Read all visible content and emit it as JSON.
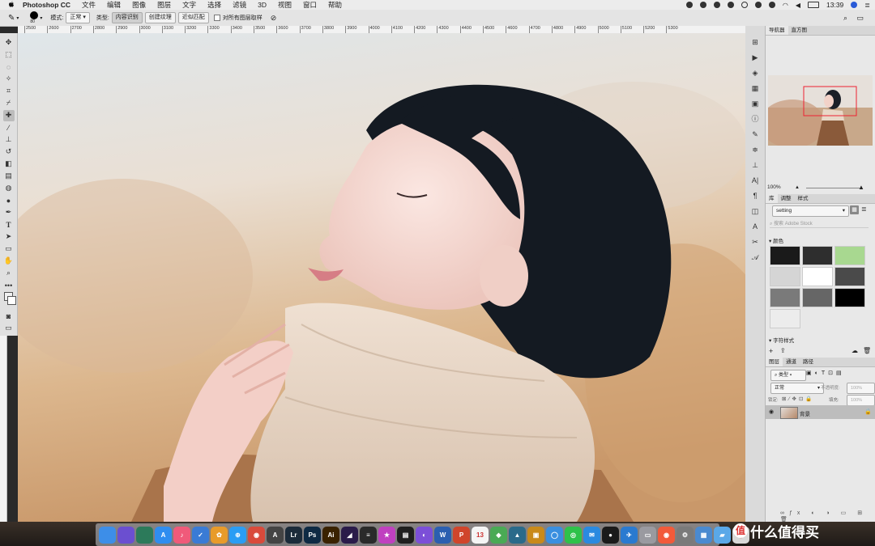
{
  "menubar": {
    "apple": "",
    "app_name": "Photoshop CC",
    "menus": [
      "文件",
      "编辑",
      "图像",
      "图层",
      "文字",
      "选择",
      "滤镜",
      "3D",
      "视图",
      "窗口",
      "帮助"
    ],
    "time": "13:39"
  },
  "options": {
    "brush_size": "80",
    "mode_label": "模式:",
    "mode_value": "正常",
    "type_label": "类型:",
    "type_buttons": [
      "内容识别",
      "创建纹理",
      "近似匹配"
    ],
    "sample_all_label": "对所有图层取样"
  },
  "ruler": [
    "2500",
    "2600",
    "2700",
    "2800",
    "2900",
    "3000",
    "3100",
    "3200",
    "3300",
    "3400",
    "3500",
    "3600",
    "3700",
    "3800",
    "3900",
    "4000",
    "4100",
    "4200",
    "4300",
    "4400",
    "4500",
    "4600",
    "4700",
    "4800",
    "4900",
    "5000",
    "5100",
    "5200",
    "5300"
  ],
  "navigator": {
    "tabs": [
      "导航器",
      "直方图"
    ],
    "zoom": "100%"
  },
  "library": {
    "tabs": [
      "库",
      "调整",
      "样式"
    ],
    "dropdown": "setting",
    "search_placeholder": "搜索 Adobe Stock",
    "colors_label": "颜色",
    "char_styles_label": "字符样式",
    "swatches": [
      "#1a1a1a",
      "#2e2e2e",
      "#a8d890",
      "#d5d5d5",
      "#ffffff",
      "#4a4a4a",
      "#7a7a7a",
      "#666666",
      "#000000",
      "#ececec"
    ]
  },
  "layers": {
    "tabs": [
      "图层",
      "通道",
      "路径"
    ],
    "filter": "类型",
    "blend": "正常",
    "opacity_label": "不透明度:",
    "opacity_value": "100%",
    "lock_label": "锁定:",
    "fill_label": "填充:",
    "fill_value": "100%",
    "layer_name": "背景"
  },
  "dock": {
    "apps": [
      {
        "name": "finder-icon",
        "label": "",
        "color": "#3d8ee8"
      },
      {
        "name": "siri-icon",
        "label": "",
        "color": "#6b4fd0"
      },
      {
        "name": "time-machine-icon",
        "label": "",
        "color": "#2c7a5a"
      },
      {
        "name": "app-store-icon",
        "label": "A",
        "color": "#2f8df0"
      },
      {
        "name": "music-icon",
        "label": "♪",
        "color": "#f05a7a"
      },
      {
        "name": "mail-icon",
        "label": "✓",
        "color": "#3a7bd5"
      },
      {
        "name": "photos-icon",
        "label": "✿",
        "color": "#e89b2a"
      },
      {
        "name": "safari-icon",
        "label": "⊕",
        "color": "#2a9df4"
      },
      {
        "name": "chrome-icon",
        "label": "◉",
        "color": "#d94a3b"
      },
      {
        "name": "typora-icon",
        "label": "A",
        "color": "#444444"
      },
      {
        "name": "lightroom-icon",
        "label": "Lr",
        "color": "#1b2b3a"
      },
      {
        "name": "photoshop-icon",
        "label": "Ps",
        "color": "#0e2a44"
      },
      {
        "name": "illustrator-icon",
        "label": "Ai",
        "color": "#3a2200"
      },
      {
        "name": "premiere-icon",
        "label": "◢",
        "color": "#2a1b4a"
      },
      {
        "name": "menu-app-icon",
        "label": "≡",
        "color": "#2a2a2a"
      },
      {
        "name": "star-app-icon",
        "label": "★",
        "color": "#c040c0"
      },
      {
        "name": "clapper-icon",
        "label": "▤",
        "color": "#1f1f1f"
      },
      {
        "name": "pixel-app-icon",
        "label": "◐",
        "color": "#7c4fd8"
      },
      {
        "name": "word-icon",
        "label": "W",
        "color": "#2b5fb0"
      },
      {
        "name": "powerpoint-icon",
        "label": "P",
        "color": "#d0452b"
      },
      {
        "name": "calendar-icon",
        "label": "13",
        "color": "#f5f5f5"
      },
      {
        "name": "maps-icon",
        "label": "◆",
        "color": "#4aaa55"
      },
      {
        "name": "vpn-icon",
        "label": "▲",
        "color": "#2a6a8a"
      },
      {
        "name": "package-icon",
        "label": "▣",
        "color": "#c98a1a"
      },
      {
        "name": "qq-chat-icon",
        "label": "◯",
        "color": "#3a8fe0"
      },
      {
        "name": "wechat-icon",
        "label": "◎",
        "color": "#2ec24a"
      },
      {
        "name": "wechat-work-icon",
        "label": "✉",
        "color": "#2a8ae0"
      },
      {
        "name": "qq-icon",
        "label": "●",
        "color": "#1a1a1a"
      },
      {
        "name": "plane-icon",
        "label": "✈",
        "color": "#2a7ad0"
      },
      {
        "name": "screen-app-icon",
        "label": "▭",
        "color": "#9a9aa0"
      },
      {
        "name": "record-icon",
        "label": "◉",
        "color": "#f25a3a"
      },
      {
        "name": "settings-icon",
        "label": "⚙",
        "color": "#7a7a7a"
      },
      {
        "name": "preview-icon",
        "label": "▦",
        "color": "#4a8ad0"
      },
      {
        "name": "folder-icon",
        "label": "▰",
        "color": "#5aa8e8"
      },
      {
        "name": "trash-icon",
        "label": "▯",
        "color": "#d8d8d8"
      }
    ]
  },
  "watermark": "什么值得买"
}
